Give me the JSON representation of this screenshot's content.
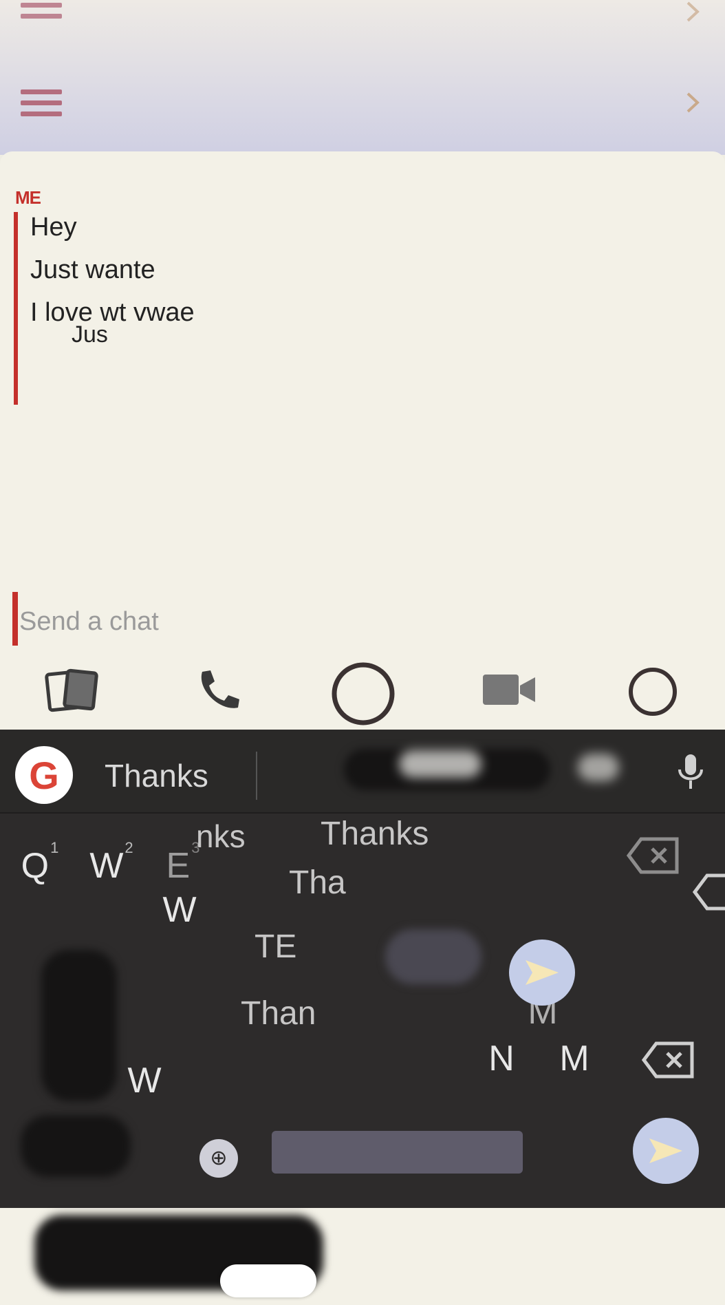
{
  "header": {
    "menu_icon": "hamburger-menu-icon",
    "forward_icon": "chevron-right-icon"
  },
  "chat": {
    "sender_tag": "ME",
    "messages": [
      "Hey",
      "Just wante",
      "I love wt vwae"
    ],
    "overlap_text": "Jus"
  },
  "input": {
    "placeholder": "Send a chat"
  },
  "actions": {
    "icons": [
      "memories-icon",
      "phone-icon",
      "capture-button-icon",
      "video-call-icon",
      "emoji-icon"
    ]
  },
  "keyboard": {
    "suggestion": "Thanks",
    "ghost_suggestions": [
      "nks",
      "Thanks",
      "Tha",
      "Than",
      "TE"
    ],
    "row1": [
      "Q",
      "W",
      "E"
    ],
    "row1_sup": [
      "1",
      "2",
      "3"
    ],
    "row_partial": [
      "N",
      "M"
    ],
    "colors": {
      "background": "#2d2b2b",
      "send": "#c4cde8",
      "accent": "#c4302b"
    }
  }
}
